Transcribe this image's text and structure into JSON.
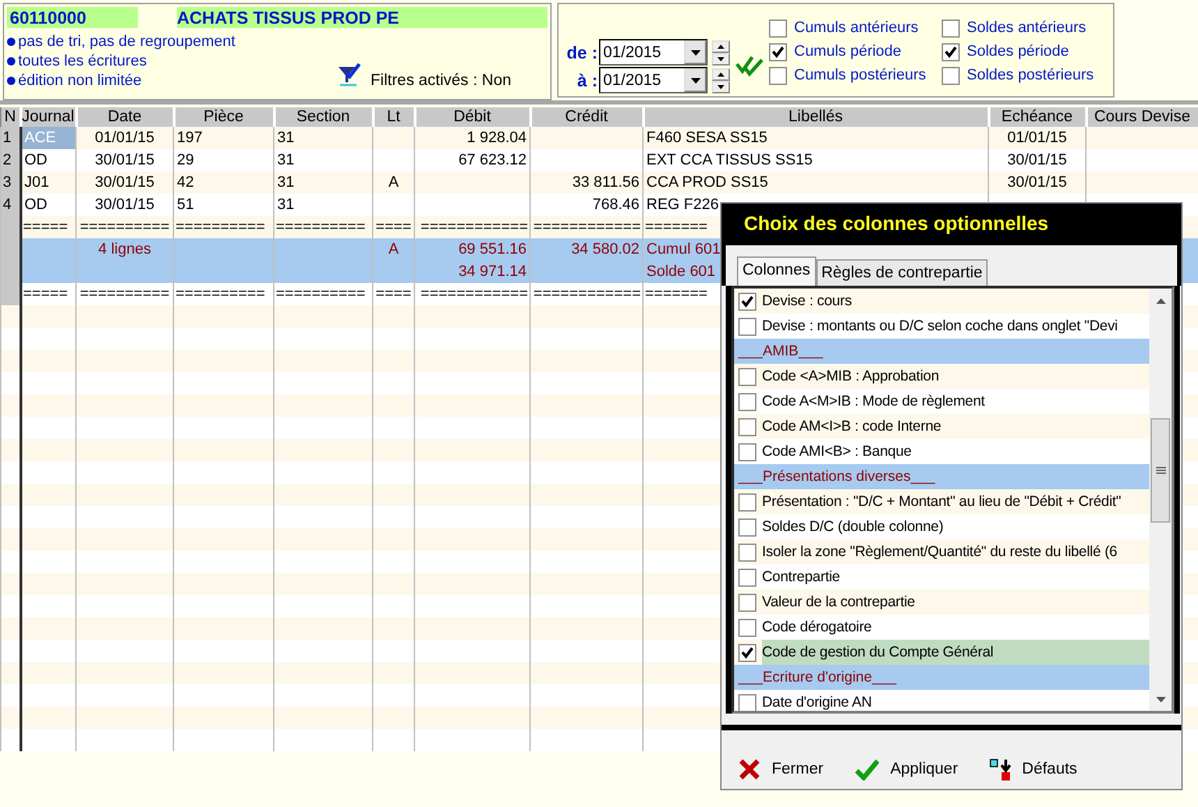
{
  "account": {
    "number": "60110000",
    "title": "ACHATS TISSUS PROD PE"
  },
  "options": [
    "pas de tri, pas de regroupement",
    "toutes les écritures",
    "édition non limitée"
  ],
  "filters": {
    "label": "Filtres activés : Non"
  },
  "period": {
    "from_label": "de :",
    "from": "01/2015",
    "to_label": "à :",
    "to": "01/2015"
  },
  "toggles": [
    {
      "label": "Cumuls antérieurs",
      "checked": false
    },
    {
      "label": "Soldes antérieurs",
      "checked": false
    },
    {
      "label": "Cumuls période",
      "checked": true
    },
    {
      "label": "Soldes période",
      "checked": true
    },
    {
      "label": "Cumuls postérieurs",
      "checked": false
    },
    {
      "label": "Soldes postérieurs",
      "checked": false
    }
  ],
  "table": {
    "columns": [
      "N",
      "Journal",
      "Date",
      "Pièce",
      "Section",
      "Lt",
      "Débit",
      "Crédit",
      "Libellés",
      "Echéance",
      "Cours Devise"
    ],
    "rows": [
      {
        "kind": "entry",
        "selected": true,
        "cells": [
          "1",
          "ACE",
          "01/01/15",
          "197",
          "31",
          "",
          "1 928.04",
          "",
          "F460 SESA SS15",
          "01/01/15",
          ""
        ]
      },
      {
        "kind": "entry",
        "selected": false,
        "cells": [
          "2",
          "OD",
          "30/01/15",
          "29",
          "31",
          "",
          "67 623.12",
          "",
          "EXT CCA TISSUS SS15",
          "30/01/15",
          ""
        ]
      },
      {
        "kind": "entry",
        "selected": false,
        "cells": [
          "3",
          "J01",
          "30/01/15",
          "42",
          "31",
          "A",
          "",
          "33 811.56",
          "CCA  PROD SS15",
          "30/01/15",
          ""
        ]
      },
      {
        "kind": "entry",
        "selected": false,
        "cells": [
          "4",
          "OD",
          "30/01/15",
          "51",
          "31",
          "",
          "",
          "768.46",
          "REG F226",
          "",
          ""
        ]
      },
      {
        "kind": "separator",
        "cells": [
          "",
          "=====",
          "==========",
          "==========",
          "==========",
          "====",
          "============",
          "============",
          "=======",
          "",
          ""
        ]
      },
      {
        "kind": "total",
        "cells": [
          "",
          "",
          "4 lignes",
          "",
          "",
          "A",
          "69 551.16",
          "34 580.02",
          "Cumul 601",
          "",
          ""
        ]
      },
      {
        "kind": "total",
        "cells": [
          "",
          "",
          "",
          "",
          "",
          "",
          "34 971.14",
          "",
          "Solde 601",
          "",
          ""
        ]
      },
      {
        "kind": "separator",
        "cells": [
          "",
          "=====",
          "==========",
          "==========",
          "==========",
          "====",
          "============",
          "============",
          "=======",
          "",
          ""
        ]
      }
    ]
  },
  "dialog": {
    "title": "Choix des colonnes optionnelles",
    "tabs": [
      {
        "label": "Colonnes",
        "selected": true
      },
      {
        "label": "Règles de contrepartie",
        "selected": false
      }
    ],
    "items": [
      {
        "kind": "option",
        "label": "Devise : cours",
        "checked": true,
        "selected": false
      },
      {
        "kind": "option",
        "label": "Devise : montants ou D/C selon coche dans onglet \"Devi",
        "checked": false,
        "selected": false
      },
      {
        "kind": "section",
        "label": "___AMIB___"
      },
      {
        "kind": "option",
        "label": "Code <A>MIB : Approbation",
        "checked": false,
        "selected": false
      },
      {
        "kind": "option",
        "label": "Code A<M>IB : Mode de règlement",
        "checked": false,
        "selected": false
      },
      {
        "kind": "option",
        "label": "Code AM<I>B : code Interne",
        "checked": false,
        "selected": false
      },
      {
        "kind": "option",
        "label": "Code AMI<B> : Banque",
        "checked": false,
        "selected": false
      },
      {
        "kind": "section",
        "label": "___Présentations diverses___"
      },
      {
        "kind": "option",
        "label": "Présentation : \"D/C + Montant\" au lieu de \"Débit + Crédit\"",
        "checked": false,
        "selected": false
      },
      {
        "kind": "option",
        "label": "Soldes D/C (double colonne)",
        "checked": false,
        "selected": false
      },
      {
        "kind": "option",
        "label": "Isoler la zone \"Règlement/Quantité\" du reste du libellé (6",
        "checked": false,
        "selected": false
      },
      {
        "kind": "option",
        "label": "Contrepartie",
        "checked": false,
        "selected": false
      },
      {
        "kind": "option",
        "label": "Valeur de la contrepartie",
        "checked": false,
        "selected": false
      },
      {
        "kind": "option",
        "label": "Code dérogatoire",
        "checked": false,
        "selected": false
      },
      {
        "kind": "option",
        "label": "Code de gestion du Compte Général",
        "checked": true,
        "selected": true
      },
      {
        "kind": "section",
        "label": "___Ecriture d'origine___"
      },
      {
        "kind": "option",
        "label": "Date d'origine AN",
        "checked": false,
        "selected": false
      }
    ],
    "buttons": [
      {
        "kind": "close",
        "label": "Fermer"
      },
      {
        "kind": "apply",
        "label": "Appliquer"
      },
      {
        "kind": "defaults",
        "label": "Défauts"
      }
    ]
  }
}
